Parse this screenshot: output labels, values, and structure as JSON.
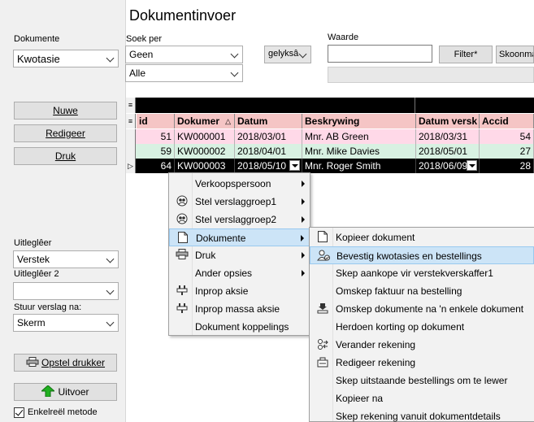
{
  "title": "Dokumentinvoer",
  "left": {
    "dokumente_label": "Dokumente",
    "dokumente_value": "Kwotasie",
    "btn_nuwe": "Nuwe",
    "btn_redigeer": "Redigeer",
    "btn_druk": "Druk",
    "uitlegleer_label": "Uitleglêer",
    "uitlegleer_value": "Verstek",
    "uitlegleer2_label": "Uitleglêer 2",
    "uitlegleer2_value": "",
    "stuur_label": "Stuur verslag na:",
    "stuur_value": "Skerm",
    "btn_opstel": "Opstel drukker",
    "btn_uitvoer": "Uitvoer",
    "enkel_label": "Enkelreël metode",
    "enkel_checked": true
  },
  "search": {
    "soek_label": "Soek per",
    "soek_value": "Geen",
    "soek2_value": "Alle",
    "op_value": "gelyksâ",
    "waarde_label": "Waarde",
    "waarde_value": "",
    "filter_btn": "Filter*",
    "skoonmaak_btn": "Skoonma"
  },
  "grid": {
    "headers": [
      "id",
      "Dokumer",
      "Datum",
      "Beskrywing",
      "Datum versk",
      "Accid"
    ],
    "rows": [
      {
        "id": "51",
        "dok": "KW000001",
        "datum": "2018/03/01",
        "besk": "Mnr. AB Green",
        "versk": "2018/03/31",
        "accid": "54"
      },
      {
        "id": "59",
        "dok": "KW000002",
        "datum": "2018/04/01",
        "besk": "Mnr. Mike Davies",
        "versk": "2018/05/01",
        "accid": "27"
      },
      {
        "id": "64",
        "dok": "KW000003",
        "datum": "2018/05/10",
        "besk": "Mnr. Roger Smith",
        "versk": "2018/06/09",
        "accid": "28"
      }
    ]
  },
  "context_menu": {
    "items": [
      {
        "label": "Verkoopspersoon",
        "icon": "none",
        "submenu": true
      },
      {
        "label": "Stel verslaggroep1",
        "icon": "group-icon",
        "submenu": true
      },
      {
        "label": "Stel verslaggroep2",
        "icon": "group-icon",
        "submenu": true
      },
      {
        "label": "Dokumente",
        "icon": "document-icon",
        "submenu": true
      },
      {
        "label": "Druk",
        "icon": "printer-icon",
        "submenu": true
      },
      {
        "label": "Ander opsies",
        "icon": "none",
        "submenu": true
      },
      {
        "label": "Inprop aksie",
        "icon": "plug-icon",
        "submenu": false
      },
      {
        "label": "Inprop massa aksie",
        "icon": "plug-icon",
        "submenu": false
      },
      {
        "label": "Dokument koppelings",
        "icon": "none",
        "submenu": false
      }
    ]
  },
  "sub_menu": {
    "items": [
      {
        "label": "Kopieer dokument",
        "icon": "document-icon"
      },
      {
        "label": "Bevestig kwotasies en bestellings",
        "icon": "user-confirm-icon"
      },
      {
        "label": "Skep aankope vir verstekverskaffer1",
        "icon": "none"
      },
      {
        "label": "Omskep faktuur na bestelling",
        "icon": "none"
      },
      {
        "label": "Omskep dokumente na 'n enkele dokument",
        "icon": "merge-icon"
      },
      {
        "label": "Herdoen korting op dokument",
        "icon": "none"
      },
      {
        "label": "Verander rekening",
        "icon": "change-account-icon"
      },
      {
        "label": "Redigeer rekening",
        "icon": "edit-account-icon"
      },
      {
        "label": "Skep uitstaande bestellings om te lewer",
        "icon": "none"
      },
      {
        "label": "Kopieer na",
        "icon": "none"
      },
      {
        "label": "Skep rekening vanuit dokumentdetails",
        "icon": "none"
      }
    ]
  }
}
